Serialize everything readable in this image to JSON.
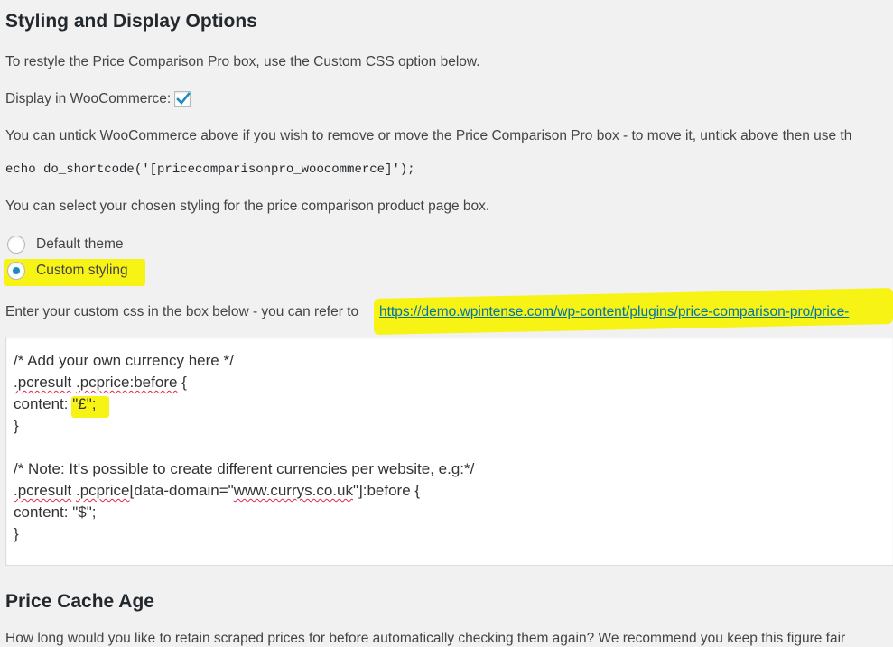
{
  "section": {
    "title": "Styling and Display Options",
    "intro": "To restyle the Price Comparison Pro box, use the Custom CSS option below.",
    "woocommerce_label": "Display in WooCommerce:",
    "woocommerce_checked": true,
    "untick_text": "You can untick WooCommerce above if you wish to remove or move the Price Comparison Pro box - to move it, untick above then use th",
    "shortcode": "echo do_shortcode('[pricecomparisonpro_woocommerce]');",
    "styling_text": "You can select your chosen styling for the price comparison product page box."
  },
  "styling_options": [
    {
      "label": "Default theme",
      "selected": false
    },
    {
      "label": "Custom styling",
      "selected": true
    }
  ],
  "custom_css": {
    "instruction": "Enter your custom css in the box below - you can refer to",
    "reference_link": "https://demo.wpintense.com/wp-content/plugins/price-comparison-pro/price-",
    "lines": {
      "l1": "/* Add your own currency here */",
      "l2a": ".pcresult",
      "l2b": ".pcprice:before",
      "l2c": " {",
      "l3a": "content: ",
      "l3b": "\"£\";",
      "l4": "}",
      "l6": "/* Note: It's possible to create different currencies per website, e.g:*/",
      "l7a": ".pcresult",
      "l7b": ".pcprice",
      "l7c": "[data-domain=\"",
      "l7d": "www.currys.co.uk",
      "l7e": "\"]:before {",
      "l8": "content: \"$\";",
      "l9": "}"
    }
  },
  "cache": {
    "title": "Price Cache Age",
    "text": "How long would you like to retain scraped prices for before automatically checking them again? We recommend you keep this figure fair"
  },
  "colors": {
    "highlight": "#f7f315",
    "link": "#0073aa",
    "radio_selected": "#1e8cbe",
    "checkmark": "#1e8cbe"
  }
}
